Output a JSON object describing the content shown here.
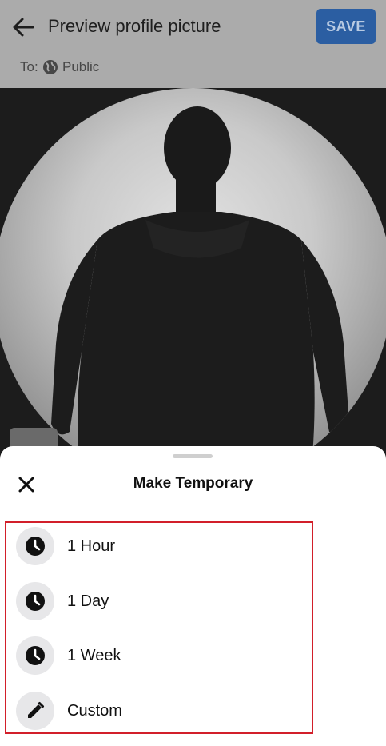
{
  "header": {
    "title": "Preview profile picture",
    "save_label": "SAVE"
  },
  "audience": {
    "prefix": "To:",
    "value": "Public"
  },
  "sheet": {
    "title": "Make Temporary",
    "options": [
      {
        "label": "1 Hour",
        "icon": "clock-icon"
      },
      {
        "label": "1 Day",
        "icon": "clock-icon"
      },
      {
        "label": "1 Week",
        "icon": "clock-icon"
      },
      {
        "label": "Custom",
        "icon": "pencil-icon"
      }
    ]
  },
  "colors": {
    "accent": "#2b5ea2",
    "highlight": "#d21f2a"
  }
}
